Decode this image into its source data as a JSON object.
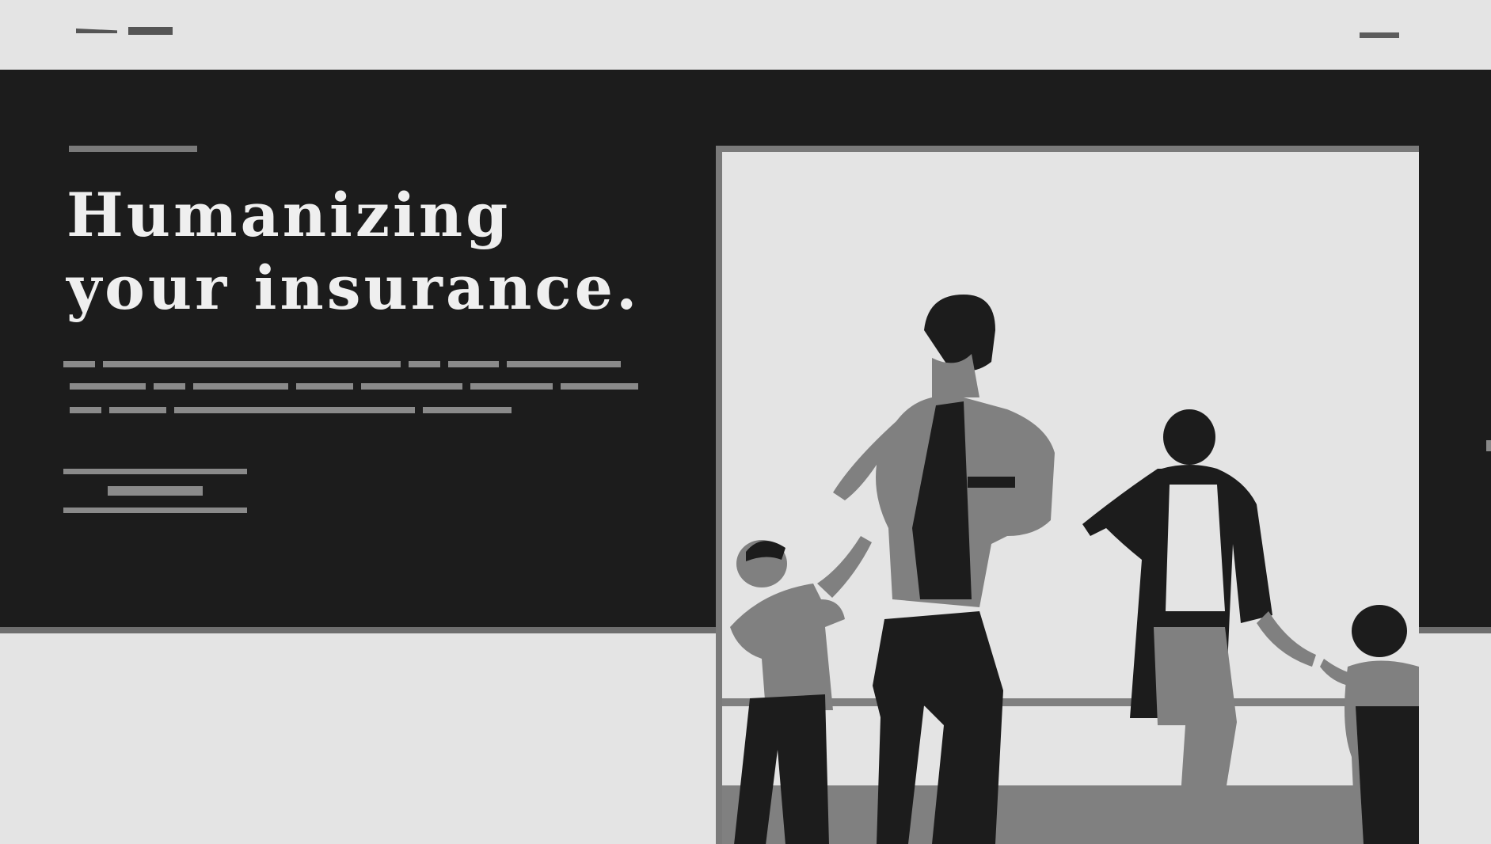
{
  "header": {
    "logo_icon": "logo-wordmark",
    "menu_icon": "hamburger-icon"
  },
  "hero": {
    "headline_line1": "Humanizing",
    "headline_line2": "your insurance.",
    "photo_subject": "family-walking-hand-in-hand",
    "colors": {
      "band": "#1c1c1c",
      "page": "#e4e4e4",
      "accent_grey": "#7a7a7a",
      "headline": "#efefef"
    }
  }
}
